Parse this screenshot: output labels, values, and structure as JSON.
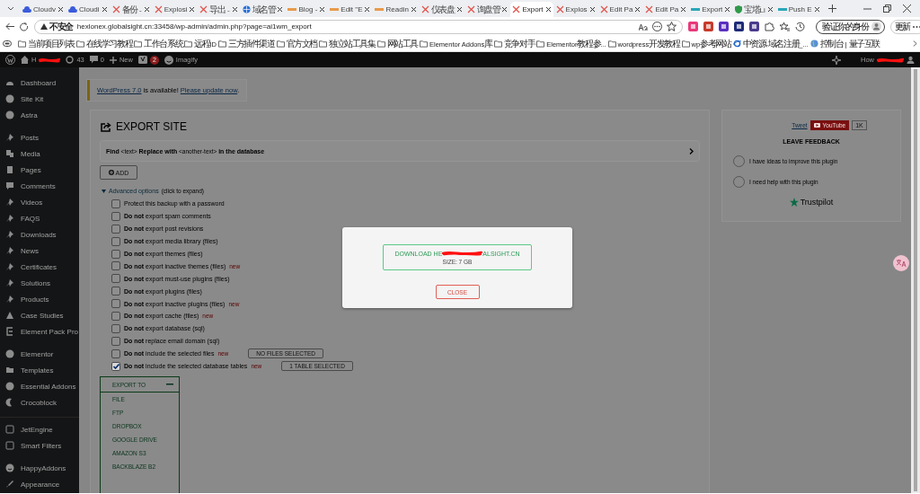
{
  "browser": {
    "tabs": [
      {
        "title": "Cloudv",
        "kind": "cloud",
        "selected": false
      },
      {
        "title": "Cloudi",
        "kind": "cloud",
        "selected": false
      },
      {
        "title": "备份 -",
        "kind": "cross",
        "selected": false
      },
      {
        "title": "Explosi",
        "kind": "cross",
        "selected": false
      },
      {
        "title": "导出 -",
        "kind": "cross",
        "selected": false
      },
      {
        "title": "域名管",
        "kind": "globe",
        "selected": false
      },
      {
        "title": "Blog -",
        "kind": "dash",
        "selected": false
      },
      {
        "title": "Edit \"E",
        "kind": "dash",
        "selected": false
      },
      {
        "title": "Readin",
        "kind": "dash",
        "selected": false
      },
      {
        "title": "仪表盘",
        "kind": "cross",
        "selected": false
      },
      {
        "title": "询盘管",
        "kind": "cross",
        "selected": false
      },
      {
        "title": "Export",
        "kind": "cross",
        "selected": true
      },
      {
        "title": "Explos",
        "kind": "cross",
        "selected": false
      },
      {
        "title": "Edit Pa",
        "kind": "cross",
        "selected": false
      },
      {
        "title": "Edit Pa",
        "kind": "cross",
        "selected": false
      },
      {
        "title": "Export",
        "kind": "bar",
        "selected": false
      },
      {
        "title": "宝塔Li",
        "kind": "shield",
        "selected": false
      },
      {
        "title": "Push E",
        "kind": "bar",
        "selected": false
      }
    ],
    "security": "不安全",
    "url": "hexlonex.globalsight.cn:33458/wp-admin/admin.php?page=ai1wm_export",
    "identity": "验证你的身份",
    "update": "更新",
    "bookmarks": [
      {
        "label": "当前项目列表",
        "kind": "folder"
      },
      {
        "label": "在线学习教程",
        "kind": "folder"
      },
      {
        "label": "工作台系统",
        "kind": "folder"
      },
      {
        "label": "远程ID",
        "kind": "folder"
      },
      {
        "label": "三方插件渠道",
        "kind": "folder"
      },
      {
        "label": "官方文档",
        "kind": "folder"
      },
      {
        "label": "独立站工具集",
        "kind": "folder"
      },
      {
        "label": "网站工具",
        "kind": "folder"
      },
      {
        "label": "Elementor Addons库",
        "kind": "folder"
      },
      {
        "label": "竞争对手",
        "kind": "folder"
      },
      {
        "label": "Elementor教程参...",
        "kind": "folder"
      },
      {
        "label": "wordpress开发教程",
        "kind": "folder"
      },
      {
        "label": "wp参考网站",
        "kind": "folder"
      },
      {
        "label": "中资源-域名注册_...",
        "kind": "browser"
      },
      {
        "label": "控制台 | 量子互联",
        "kind": "globe"
      }
    ]
  },
  "admin_bar": {
    "site": "H",
    "updates": "43",
    "comments": "0",
    "new": "New",
    "notifications": "2",
    "imagify": "Imagify",
    "howdy": "How"
  },
  "sidebar": {
    "sections": [
      {
        "items": [
          {
            "label": "Dashboard",
            "kind": "gauge"
          },
          {
            "label": "Site Kit",
            "kind": "circle"
          },
          {
            "label": "Astra",
            "kind": "circle"
          }
        ]
      },
      {
        "items": [
          {
            "label": "Posts",
            "kind": "pin"
          },
          {
            "label": "Media",
            "kind": "media"
          },
          {
            "label": "Pages",
            "kind": "page"
          },
          {
            "label": "Comments",
            "kind": "comment"
          },
          {
            "label": "Videos",
            "kind": "pin"
          },
          {
            "label": "FAQS",
            "kind": "pin"
          },
          {
            "label": "Downloads",
            "kind": "pin"
          },
          {
            "label": "News",
            "kind": "pin"
          },
          {
            "label": "Certificates",
            "kind": "pin"
          },
          {
            "label": "Solutions",
            "kind": "pin"
          },
          {
            "label": "Products",
            "kind": "pin"
          },
          {
            "label": "Case Studies",
            "kind": "triangle"
          },
          {
            "label": "Element Pack Pro",
            "kind": "bracket"
          }
        ]
      },
      {
        "items": [
          {
            "label": "Elementor",
            "kind": "circle"
          },
          {
            "label": "Templates",
            "kind": "folder"
          },
          {
            "label": "Essential Addons",
            "kind": "circle"
          },
          {
            "label": "Crocoblock",
            "kind": "crescent"
          }
        ]
      },
      {
        "items": [
          {
            "label": "JetEngine",
            "kind": "square"
          },
          {
            "label": "Smart Filters",
            "kind": "square"
          }
        ]
      },
      {
        "items": [
          {
            "label": "HappyAddons",
            "kind": "smile"
          },
          {
            "label": "Appearance",
            "kind": "brush"
          }
        ]
      }
    ]
  },
  "notice": {
    "link": "WordPress 7.0",
    "text": " is available! ",
    "action": "Please update now",
    "end": "."
  },
  "export": {
    "title": "EXPORT SITE",
    "find_replace": "**Find** <text> **Replace with** <another-text> **in the database**",
    "add": "ADD",
    "advanced": {
      "label": "Advanced options",
      "hint": "(click to expand)"
    },
    "options": [
      {
        "label": "Protect this backup with a password",
        "checked": false
      },
      {
        "label": "**Do not** export spam comments",
        "checked": false
      },
      {
        "label": "**Do not** export post revisions",
        "checked": false
      },
      {
        "label": "**Do not** export media library (files)",
        "checked": false
      },
      {
        "label": "**Do not** export themes (files)",
        "checked": false
      },
      {
        "label": "**Do not** export inactive themes (files)",
        "checked": false,
        "tag": "new"
      },
      {
        "label": "**Do not** export must-use plugins (files)",
        "checked": false
      },
      {
        "label": "**Do not** export plugins (files)",
        "checked": false
      },
      {
        "label": "**Do not** export inactive plugins (files)",
        "checked": false,
        "tag": "new"
      },
      {
        "label": "**Do not** export cache (files)",
        "checked": false,
        "tag": "new"
      },
      {
        "label": "**Do not** export database (sql)",
        "checked": false
      },
      {
        "label": "**Do not** replace email domain (sql)",
        "checked": false
      },
      {
        "label": "**Do not** include the selected files",
        "checked": false,
        "tag": "new",
        "button": "NO FILES SELECTED"
      },
      {
        "label": "**Do not** include the selected database tables",
        "checked": true,
        "tag": "new",
        "button": "1 TABLE SELECTED"
      }
    ],
    "export_to": {
      "title": "EXPORT TO",
      "items": [
        "FILE",
        "FTP",
        "DROPBOX",
        "GOOGLE DRIVE",
        "AMAZON S3",
        "BACKBLAZE B2"
      ]
    }
  },
  "feedback": {
    "tweet": "Tweet",
    "youtube": "YouTube",
    "count": "1K",
    "title": "LEAVE FEEDBACK",
    "options": [
      {
        "label": "I have ideas to improve this plugin",
        "selected": false
      },
      {
        "label": "I need help with this plugin",
        "selected": false
      }
    ],
    "trustpilot": "Trustpilot"
  },
  "modal": {
    "download_start": "DOWNLOAD HE",
    "download_end": "ALSIGHT.CN",
    "size": "SIZE: 7 GB",
    "close": "CLOSE"
  }
}
